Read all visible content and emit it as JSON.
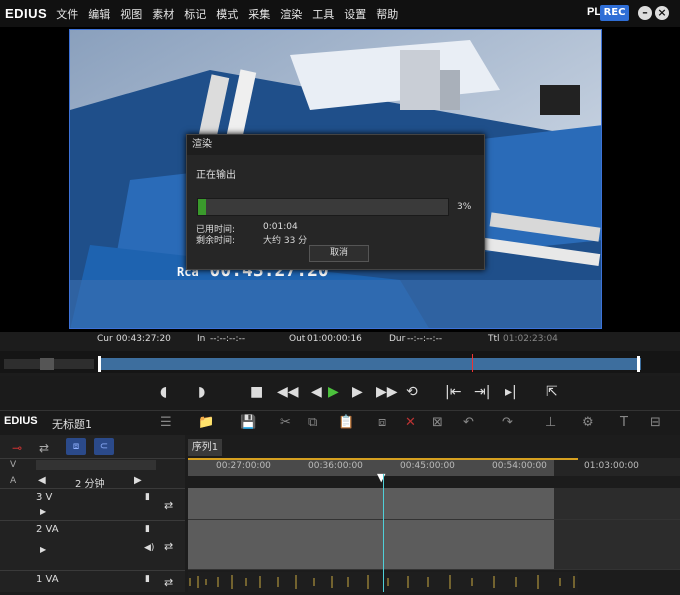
{
  "app": {
    "logo": "EDIUS"
  },
  "menu": [
    "文件",
    "编辑",
    "视图",
    "素材",
    "标记",
    "模式",
    "采集",
    "渲染",
    "工具",
    "设置",
    "帮助"
  ],
  "mode": {
    "plr": "PLR",
    "rec": "REC"
  },
  "window_buttons": {
    "minimize": "–",
    "close": "×"
  },
  "dialog": {
    "title": "渲染",
    "status": "正在输出",
    "progress_percent": 3,
    "progress_label": "3%",
    "elapsed_label": "已用时间:",
    "elapsed_value": "0:01:04",
    "remaining_label": "剩余时间:",
    "remaining_value": "大约 33 分",
    "cancel": "取消"
  },
  "overlay_timecode": "00:43:27:20",
  "overlay_prefix": "Rca",
  "timecodes": {
    "cur_label": "Cur",
    "cur": "00:43:27:20",
    "in_label": "In",
    "in": "--:--:--:--",
    "out_label": "Out",
    "out": "01:00:00:16",
    "dur_label": "Dur",
    "dur": "--:--:--:--",
    "ttl_label": "Ttl",
    "ttl": "01:02:23:04"
  },
  "project": {
    "logo": "EDIUS",
    "name": "无标题1"
  },
  "timeline": {
    "sequence_tab": "序列1",
    "zoom": "2 分钟",
    "ruler": [
      "00:27:00:00",
      "00:36:00:00",
      "00:45:00:00",
      "00:54:00:00",
      "01:03:00:00"
    ],
    "tracks": [
      {
        "type": "V",
        "label": "3 V"
      },
      {
        "type": "VA",
        "label": "2 VA"
      },
      {
        "type": "VA",
        "label": "1 VA"
      }
    ],
    "header_v": "V",
    "header_a": "A"
  },
  "colors": {
    "accent": "#2f6ed6",
    "progress": "#3a9a2c",
    "playhead": "#4fd0d8"
  }
}
